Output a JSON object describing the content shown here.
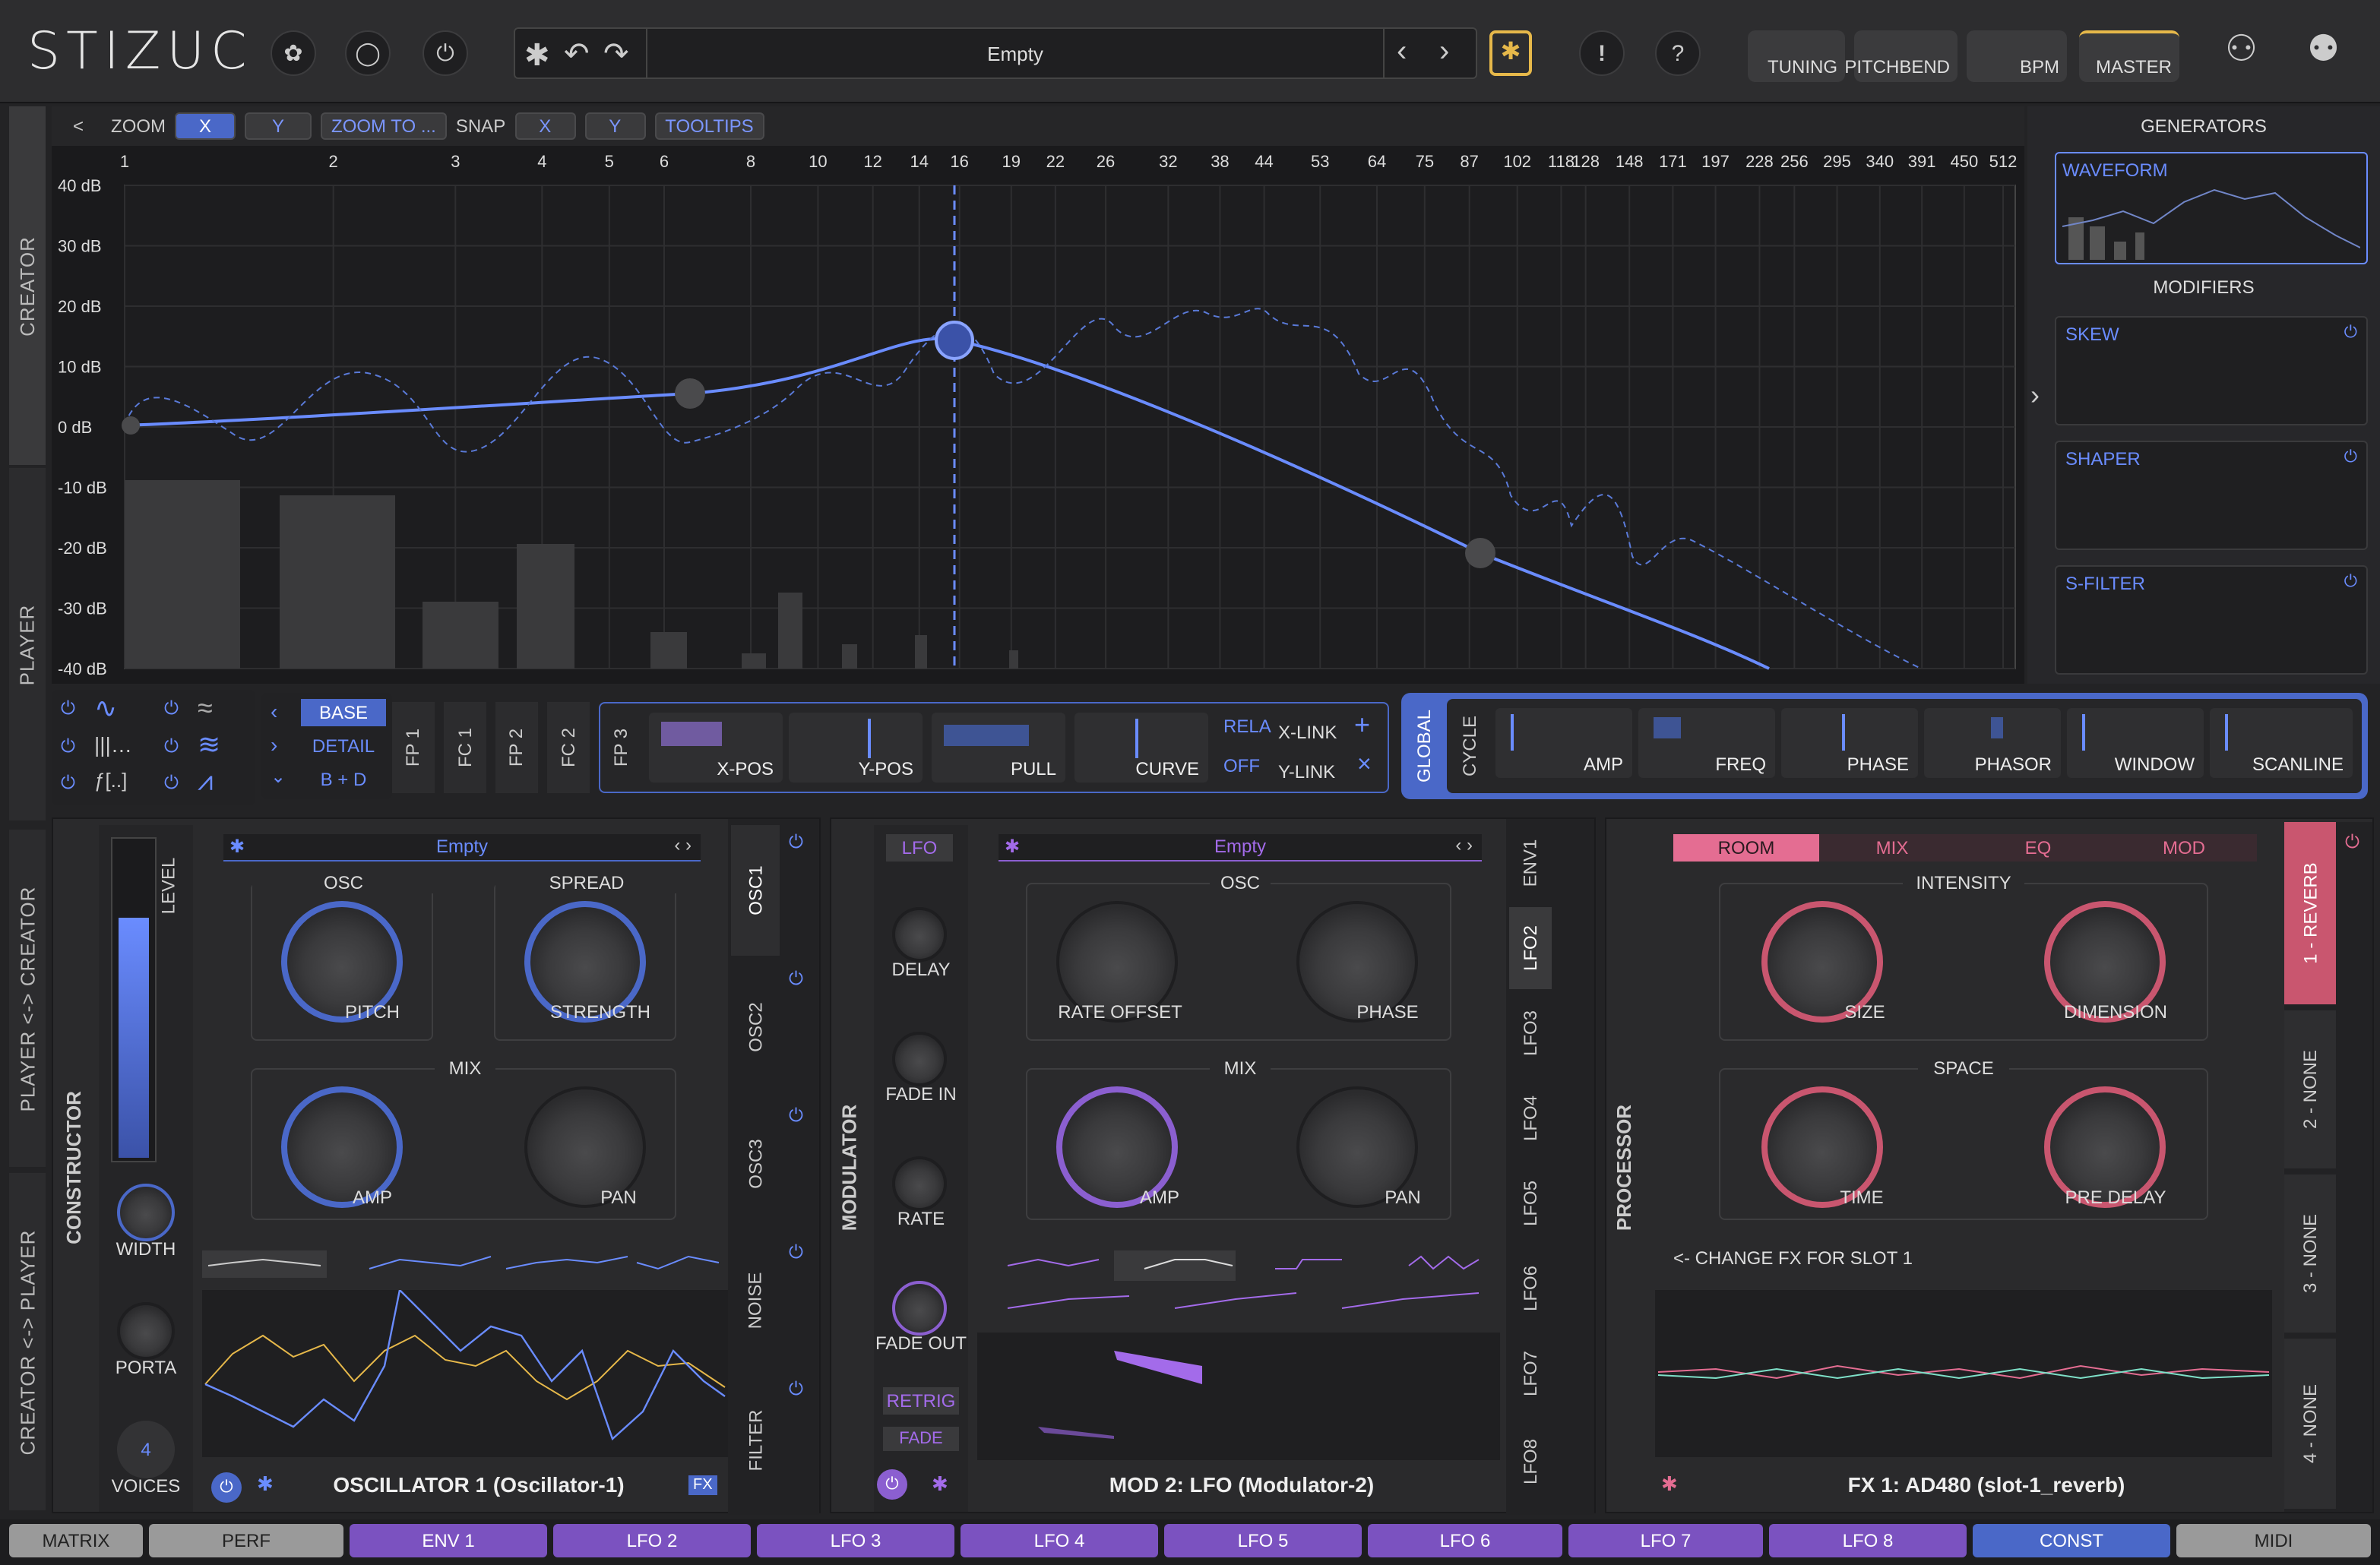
{
  "app": {
    "logo": "STIZUC"
  },
  "header": {
    "preset_name": "Empty",
    "tuning": "TUNING",
    "pitchbend": "PITCHBEND",
    "bpm": "BPM",
    "master": "MASTER",
    "warn": "!",
    "help": "?"
  },
  "sidetabs": {
    "creator": "CREATOR",
    "player": "PLAYER",
    "p2c": "PLAYER <-> CREATOR",
    "c2p": "CREATOR <-> PLAYER"
  },
  "toolbar": {
    "back": "<",
    "zoom": "ZOOM",
    "x": "X",
    "y": "Y",
    "zoom_to": "ZOOM TO ...",
    "snap": "SNAP",
    "snap_x": "X",
    "snap_y": "Y",
    "tooltips": "TOOLTIPS"
  },
  "graph": {
    "x_ticks": [
      "1",
      "2",
      "3",
      "4",
      "5",
      "6",
      "8",
      "10",
      "12",
      "14",
      "16",
      "19",
      "22",
      "26",
      "32",
      "38",
      "44",
      "53",
      "64",
      "75",
      "87",
      "102",
      "118",
      "128",
      "148",
      "171",
      "197",
      "228",
      "256",
      "295",
      "340",
      "391",
      "450",
      "512"
    ],
    "y_ticks": [
      "40 dB",
      "30 dB",
      "20 dB",
      "10 dB",
      "0 dB",
      "-10 dB",
      "-20 dB",
      "-30 dB",
      "-40 dB"
    ]
  },
  "right_panel": {
    "generators": "GENERATORS",
    "waveform": "WAVEFORM",
    "modifiers": "MODIFIERS",
    "skew": "SKEW",
    "shaper": "SHAPER",
    "sfilter": "S-FILTER"
  },
  "edit_row": {
    "base": "BASE",
    "detail": "DETAIL",
    "bd": "B + D",
    "fp1": "FP 1",
    "fc1": "FC 1",
    "fp2": "FP 2",
    "fc2": "FC 2",
    "fp3": "FP 3",
    "xpos": "X-POS",
    "ypos": "Y-POS",
    "pull": "PULL",
    "curve": "CURVE",
    "rela": "RELA",
    "off": "OFF",
    "xlink": "X-LINK",
    "ylink": "Y-LINK",
    "global": "GLOBAL",
    "cycle": "CYCLE",
    "amp": "AMP",
    "freq": "FREQ",
    "phase": "PHASE",
    "phasor": "PHASOR",
    "window": "WINDOW",
    "scanline": "SCANLINE"
  },
  "constructor": {
    "title": "CONSTRUCTOR",
    "level": "LEVEL",
    "width": "WIDTH",
    "porta": "PORTA",
    "voices_value": "4",
    "voices": "VOICES",
    "preset": "Empty",
    "osc": "OSC",
    "spread": "SPREAD",
    "pitch": "PITCH",
    "strength": "STRENGTH",
    "mix": "MIX",
    "amp": "AMP",
    "pan": "PAN",
    "footer": "OSCILLATOR 1 (Oscillator-1)",
    "fx": "FX",
    "tabs": [
      "OSC1",
      "OSC2",
      "OSC3",
      "NOISE",
      "FILTER"
    ]
  },
  "modulator": {
    "title": "MODULATOR",
    "lfo": "LFO",
    "delay": "DELAY",
    "fade_in": "FADE IN",
    "rate": "RATE",
    "fade_out": "FADE OUT",
    "retrig": "RETRIG",
    "fade": "FADE",
    "preset": "Empty",
    "osc": "OSC",
    "rate_offset": "RATE OFFSET",
    "phase": "PHASE",
    "mix": "MIX",
    "amp": "AMP",
    "pan": "PAN",
    "footer": "MOD 2: LFO (Modulator-2)",
    "tabs": [
      "ENV1",
      "LFO2",
      "LFO3",
      "LFO4",
      "LFO5",
      "LFO6",
      "LFO7",
      "LFO8"
    ]
  },
  "processor": {
    "title": "PROCESSOR",
    "tabs": [
      "ROOM",
      "MIX",
      "EQ",
      "MOD"
    ],
    "intensity": "INTENSITY",
    "size": "SIZE",
    "dimension": "DIMENSION",
    "space": "SPACE",
    "time": "TIME",
    "pre_delay": "PRE DELAY",
    "change_fx": "<- CHANGE FX FOR SLOT 1",
    "footer": "FX 1: AD480 (slot-1_reverb)",
    "slots": [
      "1 - REVERB",
      "2 - NONE",
      "3 - NONE",
      "4 - NONE"
    ]
  },
  "bottom": {
    "tabs": [
      "MATRIX",
      "PERF",
      "ENV 1",
      "LFO 2",
      "LFO 3",
      "LFO 4",
      "LFO 5",
      "LFO 6",
      "LFO 7",
      "LFO 8",
      "CONST",
      "MIDI"
    ]
  },
  "colors": {
    "blue": "#6a8cff",
    "purple": "#a36bea",
    "pink": "#e46d92"
  }
}
